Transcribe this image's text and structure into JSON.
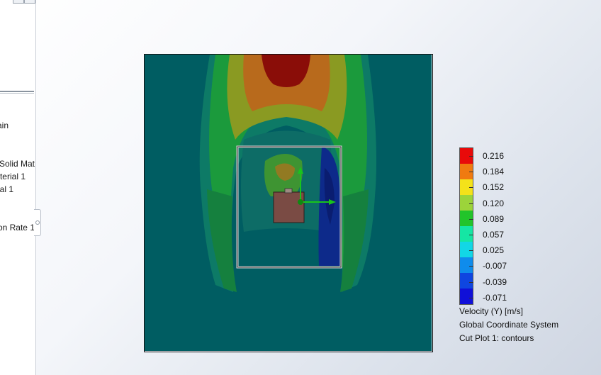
{
  "feature_tree": {
    "items": [
      {
        "label": "ain"
      },
      {
        "label": "Solid Mat"
      },
      {
        "label": "terial 1"
      },
      {
        "label": "al 1"
      },
      {
        "label": "on Rate 1"
      }
    ]
  },
  "cut_plot": {
    "background_color": "#005d62",
    "body_color": "#7a4b44",
    "axis_color": "#19c41c"
  },
  "legend": {
    "ticks": [
      "0.216",
      "0.184",
      "0.152",
      "0.120",
      "0.089",
      "0.057",
      "0.025",
      "-0.007",
      "-0.039",
      "-0.071"
    ],
    "colors": [
      "#e80a0a",
      "#f07a10",
      "#f4e21a",
      "#9cd43a",
      "#22c42a",
      "#15e6a4",
      "#12d7e6",
      "#0f8cec",
      "#0f46e0",
      "#1010d8"
    ],
    "title": "Velocity (Y) [m/s]",
    "coordinate_system": "Global Coordinate System",
    "plot_name": "Cut Plot 1: contours"
  }
}
